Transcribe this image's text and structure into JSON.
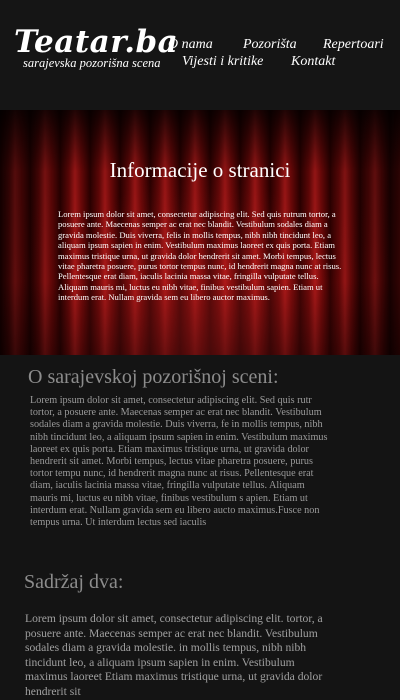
{
  "header": {
    "logo_title": "Teatar.ba",
    "logo_subtitle": "sarajevska pozorišna scena",
    "nav": [
      "O nama",
      "Pozorišta",
      "Repertoari",
      "Vijesti i kritike",
      "Kontakt"
    ]
  },
  "hero": {
    "title": "Informacije o stranici",
    "text": "Lorem ipsum dolor sit amet, consectetur adipiscing elit. Sed quis rutrum tortor, a posuere ante. Maecenas semper ac erat nec blandit. Vestibulum sodales diam a gravida molestie. Duis viverra, felis in mollis tempus, nibh nibh tincidunt leo, a aliquam ipsum sapien in enim. Vestibulum maximus laoreet ex quis porta. Etiam maximus tristique urna, ut gravida dolor hendrerit sit amet. Morbi tempus, lectus vitae pharetra posuere, purus tortor tempus nunc, id hendrerit magna nunc at risus. Pellentesque erat diam, iaculis lacinia massa vitae, fringilla vulputate tellus. Aliquam mauris mi, luctus eu nibh vitae, finibus vestibulum sapien. Etiam ut interdum erat. Nullam gravida sem eu libero auctor maximus."
  },
  "section1": {
    "title": "O sarajevskoj pozorišnoj sceni:",
    "text": "Lorem ipsum dolor sit amet, consectetur adipiscing elit. Sed quis rutr tortor, a posuere ante. Maecenas semper ac erat nec blandit. Vestibulum sodales diam a gravida molestie. Duis viverra, fe in mollis tempus, nibh nibh tincidunt leo, a aliquam ipsum sapien in enim. Vestibulum maximus laoreet ex quis porta. Etiam maximus tristique urna, ut gravida dolor hendrerit sit amet. Morbi tempus, lectus vitae pharetra posuere, purus tortor tempu nunc, id hendrerit magna nunc at risus. Pellentesque erat diam, iaculis lacinia massa vitae, fringilla vulputate tellus. Aliquam mauris mi, luctus eu nibh vitae, finibus vestibulum s apien. Etiam ut interdum erat. Nullam gravida sem eu libero aucto maximus.Fusce non tempus urna. Ut interdum lectus sed iaculis"
  },
  "section2": {
    "title": "Sadržaj dva:",
    "text": "Lorem ipsum dolor sit amet, consectetur adipiscing elit. tortor, a posuere ante. Maecenas semper ac erat nec blandit. Vestibulum sodales diam a gravida molestie. in mollis tempus, nibh nibh tincidunt leo, a aliquam ipsum sapien in enim. Vestibulum maximus laoreet Etiam maximus tristique urna, ut gravida dolor hendrerit sit"
  }
}
